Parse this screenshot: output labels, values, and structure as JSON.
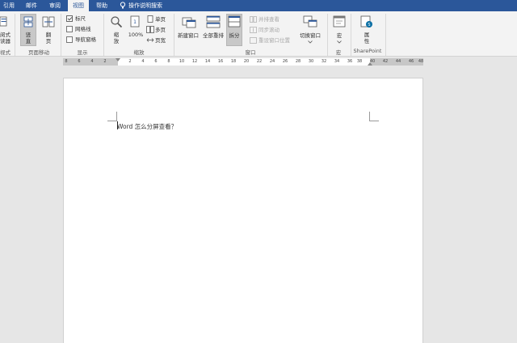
{
  "tabs": [
    {
      "label": "引用",
      "active": false
    },
    {
      "label": "邮件",
      "active": false
    },
    {
      "label": "审阅",
      "active": false
    },
    {
      "label": "视图",
      "active": true
    },
    {
      "label": "帮助",
      "active": false
    }
  ],
  "tell_me": "操作说明搜索",
  "ribbon": {
    "views_group": {
      "label": "视式",
      "buttons": [
        "阅式",
        "读器"
      ]
    },
    "page_movement": {
      "label": "页面移动",
      "vertical_lines": [
        "竖",
        "直"
      ],
      "side_lines": [
        "翻",
        "页"
      ]
    },
    "show": {
      "label": "显示",
      "ruler": {
        "label": "标尺",
        "checked": true
      },
      "gridlines": {
        "label": "网格线",
        "checked": false
      },
      "nav_pane": {
        "label": "导航窗格",
        "checked": false
      }
    },
    "zoom": {
      "label": "缩放",
      "zoom_lines": [
        "缩",
        "放"
      ],
      "percent": "100%",
      "one_page": "单页",
      "multi_page": "多页",
      "page_width": "页宽"
    },
    "window": {
      "label": "窗口",
      "new_window": "新建窗口",
      "arrange_all": "全部重排",
      "split": "拆分",
      "side_by_side": "并排查看",
      "sync_scroll": "同步滚动",
      "reset_position": "重设窗口位置",
      "switch_windows": "切换窗口"
    },
    "macros": {
      "label": "宏",
      "button": "宏"
    },
    "sharepoint": {
      "label": "SharePoint",
      "properties_lines": [
        "属",
        "性"
      ]
    }
  },
  "ruler": {
    "left_labels": [
      "8",
      "6",
      "4",
      "2"
    ],
    "right_labels": [
      "2",
      "4",
      "6",
      "8",
      "10",
      "12",
      "14",
      "16",
      "18",
      "20",
      "22",
      "24",
      "26",
      "28",
      "30",
      "32",
      "34",
      "36",
      "38",
      "40",
      "42",
      "44",
      "46",
      "48"
    ]
  },
  "document": {
    "text": "Word 怎么分屏查看？"
  },
  "colors": {
    "accent": "#2b579a",
    "ribbon_bg": "#f3f3f3",
    "workspace_bg": "#e6e6e6"
  }
}
